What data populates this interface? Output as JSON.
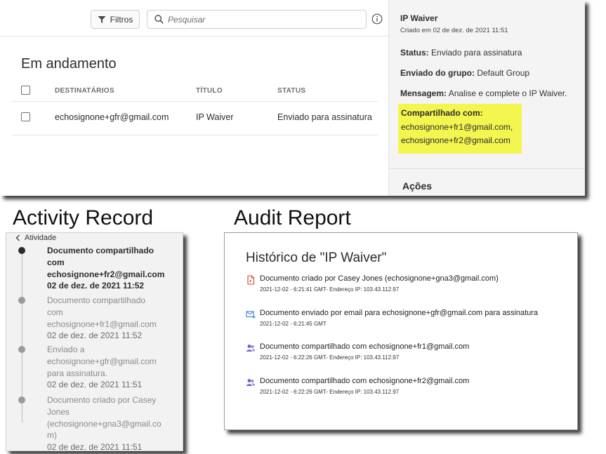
{
  "toolbar": {
    "filters_label": "Filtros",
    "search_placeholder": "Pesquisar"
  },
  "agreements": {
    "section_title": "Em andamento",
    "columns": [
      "DESTINATÁRIOS",
      "TÍTULO",
      "STATUS"
    ],
    "rows": [
      {
        "recipients": "echosignone+gfr@gmail.com",
        "title": "IP Waiver",
        "status": "Enviado para assinatura"
      }
    ]
  },
  "details": {
    "title": "IP Waiver",
    "created": "Criado em 02 de dez. de 2021 11:51",
    "status_label": "Status:",
    "status_value": "Enviado para assinatura",
    "group_label": "Enviado do grupo:",
    "group_value": "Default Group",
    "message_label": "Mensagem:",
    "message_value": "Analise e complete o IP Waiver.",
    "shared_label": "Compartilhado com:",
    "shared_emails": [
      "echosignone+fr1@gmail.com,",
      "echosignone+fr2@gmail.com"
    ],
    "actions_label": "Ações",
    "highlight_color": "#f3f64f"
  },
  "headings": {
    "activity": "Activity Record",
    "audit": "Audit Report"
  },
  "activity": {
    "back_label": "Atividade",
    "items": [
      {
        "lines": [
          "Documento compartilhado",
          "com",
          "echosignone+fr2@gmail.com"
        ],
        "date": "02 de dez. de 2021 11:52",
        "active": true
      },
      {
        "lines": [
          "Documento compartilhado",
          "com",
          "echosignone+fr1@gmail.com"
        ],
        "date": "02 de dez. de 2021 11:52",
        "active": false
      },
      {
        "lines": [
          "Enviado a",
          "echosignone+gfr@gmail.com",
          "para assinatura."
        ],
        "date": "02 de dez. de 2021 11:51",
        "active": false
      },
      {
        "lines": [
          "Documento criado por Casey",
          "Jones",
          "(echosignone+gna3@gmail.co",
          "m)"
        ],
        "date": "02 de dez. de 2021 11:51",
        "active": false
      }
    ]
  },
  "audit": {
    "title": "Histórico de \"IP Waiver\"",
    "events": [
      {
        "icon": "document-created-icon",
        "text": "Documento criado por Casey Jones (echosignone+gna3@gmail.com)",
        "meta": "2021-12-02 - 6:21:41 GMT- Endereço IP: 103.43.112.97"
      },
      {
        "icon": "email-sent-icon",
        "text": "Documento enviado por email para echosignone+gfr@gmail.com para assinatura",
        "meta": "2021-12-02 - 6:21:45 GMT"
      },
      {
        "icon": "shared-users-icon",
        "text": "Documento compartilhado com echosignone+fr1@gmail.com",
        "meta": "2021-12-02 - 6:22:26 GMT- Endereço IP: 103.43.112.97"
      },
      {
        "icon": "shared-users-icon",
        "text": "Documento compartilhado com echosignone+fr2@gmail.com",
        "meta": "2021-12-02 - 6:22:26 GMT- Endereço IP: 103.43.112.97"
      }
    ]
  }
}
